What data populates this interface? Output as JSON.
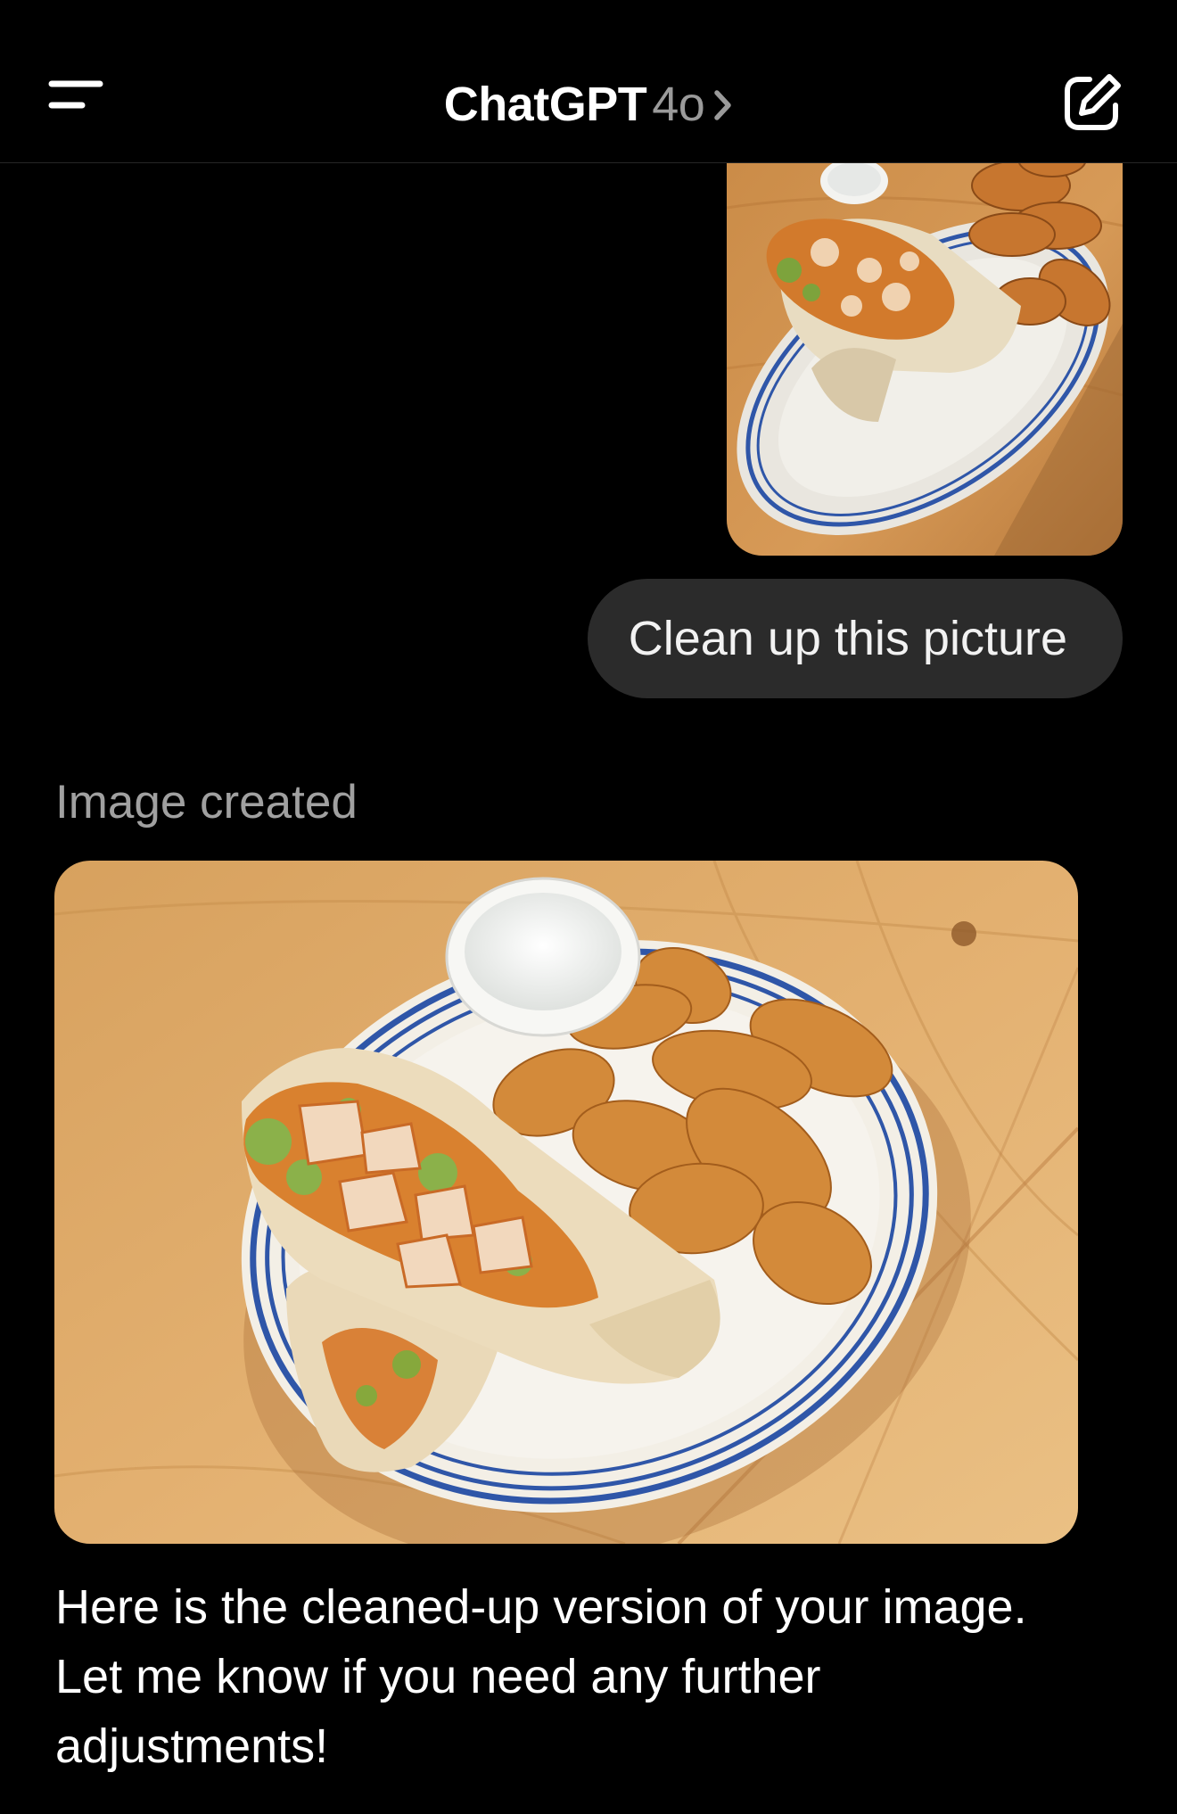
{
  "header": {
    "title": "ChatGPT",
    "model": "4o",
    "menu_icon": "menu-icon",
    "chevron_icon": "chevron-right-icon",
    "new_chat_icon": "compose-icon"
  },
  "conversation": {
    "user_message": {
      "image": "user-uploaded-food-photo",
      "text": "Clean up this picture"
    },
    "assistant_message": {
      "status": "Image created",
      "image": "generated-food-photo",
      "text": "Here is the cleaned-up version of your image. Let me know if you need any further adjustments!"
    }
  },
  "colors": {
    "background": "#000000",
    "bubble": "#2b2b2b",
    "muted_text": "#a0a0a0",
    "text": "#ffffff",
    "plate_stripe": "#2f56a8",
    "wood": "#d9a566"
  }
}
